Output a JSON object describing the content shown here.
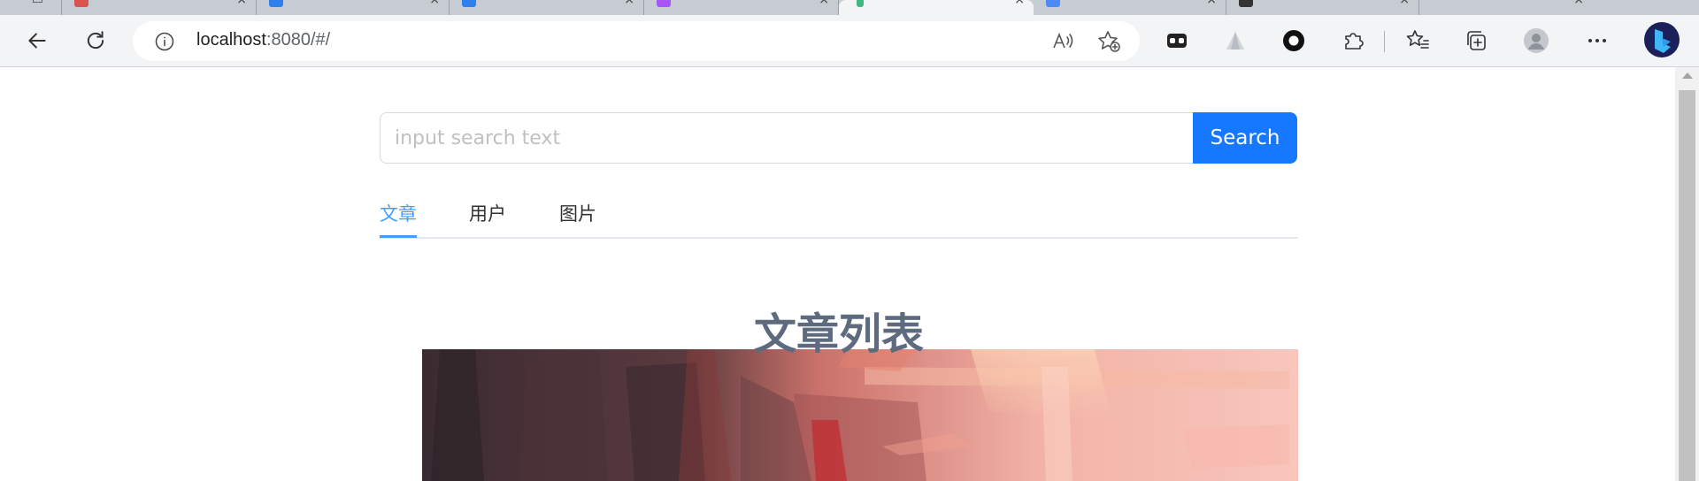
{
  "browser": {
    "url_host": "localhost",
    "url_rest": ":8080/#/",
    "tabs": [
      {
        "label": "",
        "icon_color": "#d9544f"
      },
      {
        "label": "",
        "icon_color": "#2f80ed"
      },
      {
        "label": "",
        "icon_color": "#2f80ed"
      },
      {
        "label": "",
        "icon_color": "#a855f7"
      },
      {
        "label": "",
        "icon_color": "#41b883",
        "active": true
      },
      {
        "label": "",
        "icon_color": "#4c8bf5"
      },
      {
        "label": "",
        "icon_color": "#333333"
      },
      {
        "label": "",
        "icon_color": "#888888"
      }
    ]
  },
  "search": {
    "placeholder": "input search text",
    "value": "",
    "button_label": "Search"
  },
  "tabs": [
    {
      "label": "文章",
      "active": true
    },
    {
      "label": "用户",
      "active": false
    },
    {
      "label": "图片",
      "active": false
    }
  ],
  "main": {
    "title": "文章列表"
  },
  "colors": {
    "primary": "#1677ff",
    "tab_active": "#409eff",
    "title": "#5e6b7e"
  }
}
